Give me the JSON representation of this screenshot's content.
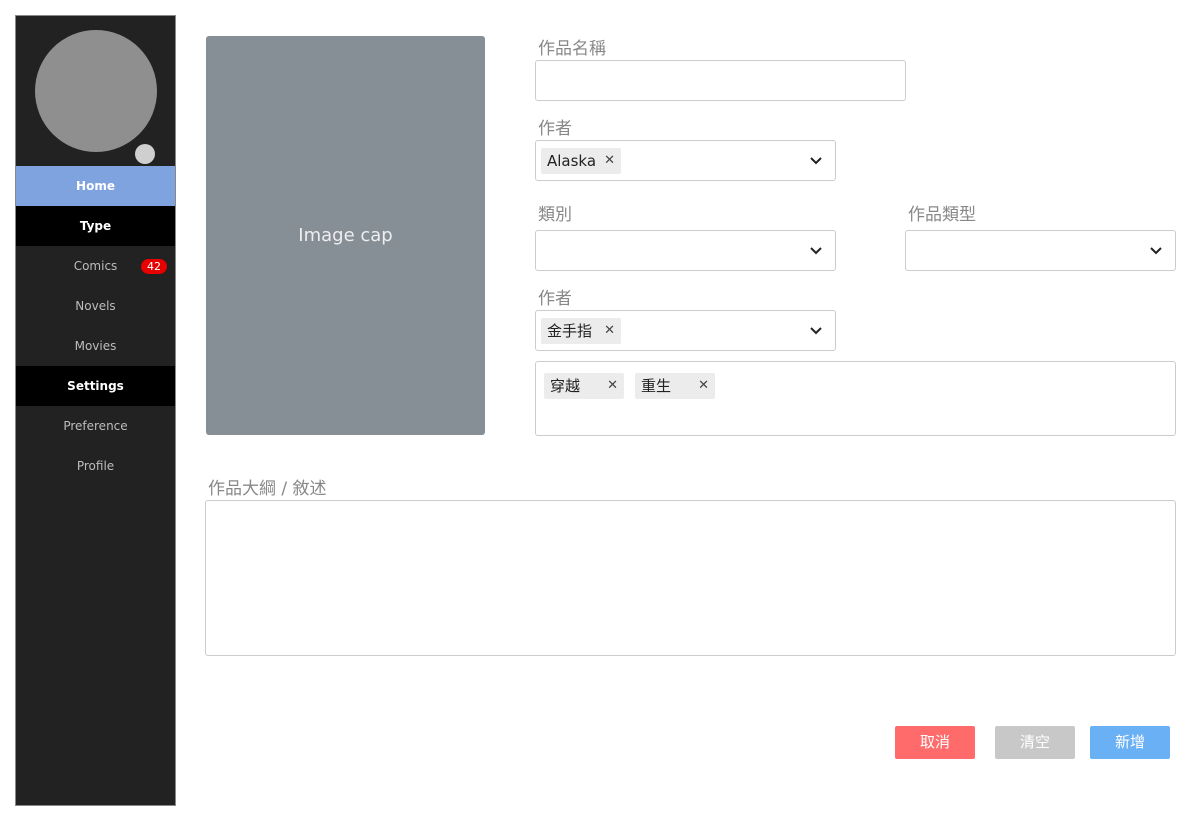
{
  "sidebar": {
    "items": [
      {
        "label": "Home"
      },
      {
        "label": "Type"
      },
      {
        "label": "Comics",
        "badge": "42"
      },
      {
        "label": "Novels"
      },
      {
        "label": "Movies"
      },
      {
        "label": "Settings"
      },
      {
        "label": "Preference"
      },
      {
        "label": "Profile"
      }
    ]
  },
  "image": {
    "caption": "Image cap"
  },
  "form": {
    "title_label": "作品名稱",
    "title_value": "",
    "author_label": "作者",
    "author_tags": [
      "Alaska"
    ],
    "category_label": "類別",
    "work_type_label": "作品類型",
    "author2_label": "作者",
    "author2_tags": [
      "金手指"
    ],
    "genre_tags": [
      "穿越",
      "重生"
    ],
    "synopsis_label": "作品大綱 / 敘述",
    "synopsis_value": ""
  },
  "buttons": {
    "cancel": "取消",
    "clear": "清空",
    "add": "新增"
  },
  "colors": {
    "cancel": "#ff6b6b",
    "clear": "#c8c8c8",
    "add": "#6ab0f5",
    "active_nav": "#7ea3df"
  },
  "icons": {
    "dropdown": "chevron-down-icon",
    "remove_tag": "close-icon"
  }
}
